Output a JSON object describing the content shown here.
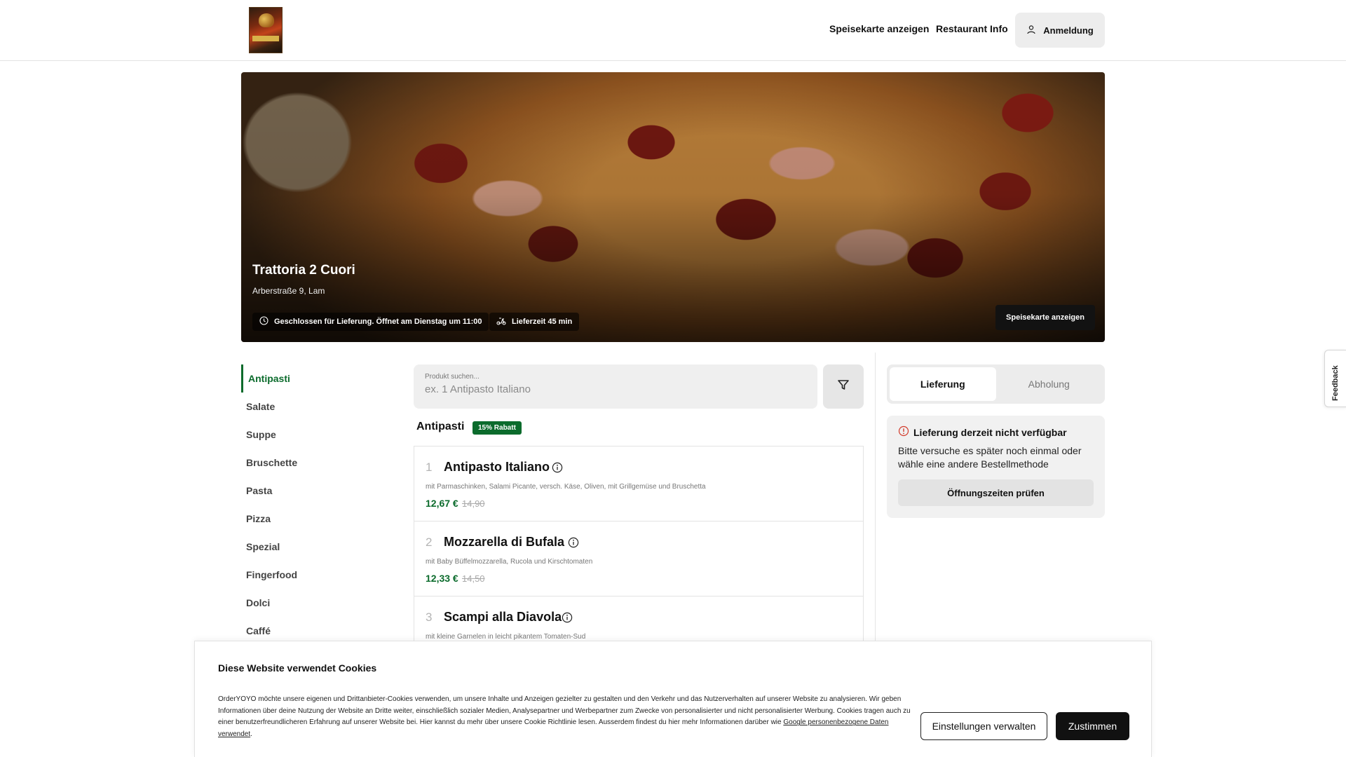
{
  "header": {
    "logo_icon": "restaurant-logo",
    "nav": [
      "Speisekarte anzeigen",
      "Restaurant Info"
    ],
    "login_label": "Anmeldung",
    "login_icon": "user-icon"
  },
  "hero": {
    "title": "Trattoria 2 Cuori",
    "address": "Arberstraße 9, Lam",
    "status_text": "Geschlossen für Lieferung. Öffnet am Dienstag um 11:00",
    "status_icon": "clock-icon",
    "delivery_time": "Lieferzeit 45 min",
    "delivery_icon": "scooter-icon",
    "menu_button": "Speisekarte anzeigen"
  },
  "categories": [
    {
      "label": "Antipasti",
      "active": true
    },
    {
      "label": "Salate"
    },
    {
      "label": "Suppe"
    },
    {
      "label": "Bruschette"
    },
    {
      "label": "Pasta"
    },
    {
      "label": "Pizza"
    },
    {
      "label": "Spezial"
    },
    {
      "label": "Fingerfood"
    },
    {
      "label": "Dolci"
    },
    {
      "label": "Caffé"
    }
  ],
  "search": {
    "label": "Produkt suchen...",
    "placeholder": "ex. 1 Antipasto Italiano",
    "filter_icon": "filter-icon"
  },
  "section": {
    "title": "Antipasti",
    "badge": "15% Rabatt"
  },
  "products": [
    {
      "num": "1",
      "name": "Antipasto Italiano",
      "desc": "mit Parmaschinken, Salami Picante, versch. Käse, Oliven, mit Grillgemüse und Bruschetta",
      "price": "12,67 €",
      "old": "14,90"
    },
    {
      "num": "2",
      "name": "Mozzarella di Bufala",
      "desc": "mit Baby Büffelmozzarella, Rucola und Kirschtomaten",
      "price": "12,33 €",
      "old": "14,50"
    },
    {
      "num": "3",
      "name": "Scampi alla Diavola",
      "desc": "mit kleine Garnelen in leicht pikantem Tomaten-Sud",
      "price": "",
      "old": ""
    }
  ],
  "order_mode": {
    "options": [
      "Lieferung",
      "Abholung"
    ],
    "selected": "Lieferung"
  },
  "notice": {
    "icon": "info-circle-icon",
    "title": "Lieferung derzeit nicht verfügbar",
    "body": "Bitte versuche es später noch einmal oder wähle eine andere Bestellmethode",
    "button": "Öffnungszeiten prüfen"
  },
  "feedback_tab": "Feedback",
  "cookie": {
    "title": "Diese Website verwendet Cookies",
    "text": "OrderYOYO möchte unsere eigenen und Drittanbieter-Cookies verwenden, um unsere Inhalte und Anzeigen gezielter zu gestalten und den Verkehr und das Nutzerverhalten auf unserer Website zu analysieren. Wir geben Informationen über deine Nutzung der Website an Dritte weiter, einschließlich sozialer Medien, Analysepartner und Werbepartner zum Zwecke von personalisierter und nicht personalisierter Werbung. Cookies tragen auch zu einer benutzerfreundlicheren Erfahrung auf unserer Website bei. Hier kannst du mehr über unsere Cookie Richtlinie lesen. Ausserdem findest du hier mehr Informationen darüber wie ",
    "link": "Google personenbezogene Daten verwendet",
    "text_end": ".",
    "manage_button": "Einstellungen verwalten",
    "accept_button": "Zustimmen"
  },
  "colors": {
    "accent_green": "#0b6b2c",
    "alert_red": "#d23b2b",
    "dark_button": "#111111"
  }
}
